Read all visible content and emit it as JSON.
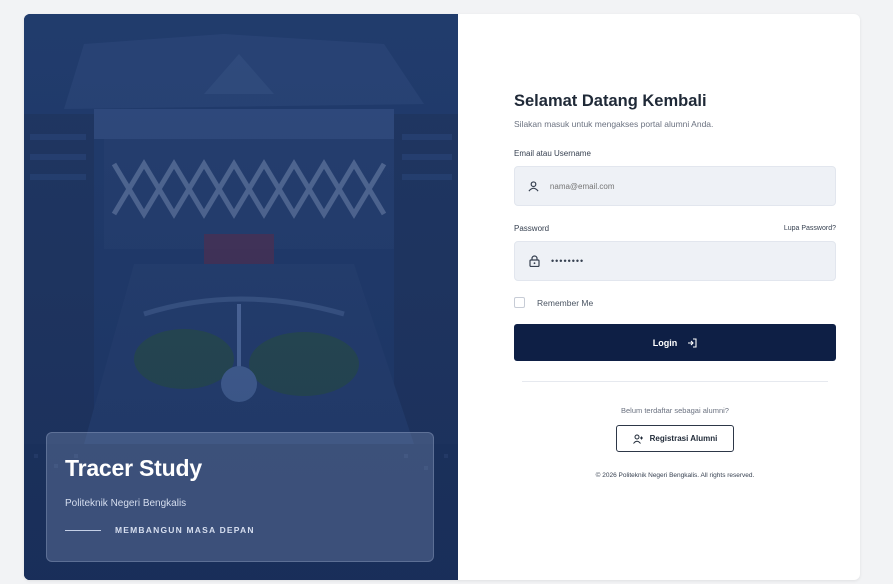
{
  "hero": {
    "title": "Tracer Study",
    "subtitle": "Politeknik Negeri Bengkalis",
    "tagline": "MEMBANGUN MASA DEPAN"
  },
  "login": {
    "title": "Selamat Datang Kembali",
    "subtitle": "Silakan masuk untuk mengakses portal alumni Anda.",
    "email_label": "Email atau Username",
    "email_placeholder": "nama@email.com",
    "password_label": "Password",
    "forgot_label": "Lupa Password?",
    "password_value": "••••••••",
    "remember_label": "Remember Me",
    "login_label": "Login"
  },
  "register": {
    "prompt": "Belum terdaftar sebagai alumni?",
    "button_label": "Registrasi Alumni"
  },
  "footer": {
    "copyright": "© 2026 Politeknik Negeri Bengkalis. All rights reserved."
  },
  "icons": {
    "user": "user-icon",
    "lock": "lock-icon",
    "login_arrow": "login-arrow-icon",
    "register": "user-plus-icon"
  },
  "colors": {
    "primary": "#0e1f45",
    "hero_tint": "#1d3566"
  }
}
